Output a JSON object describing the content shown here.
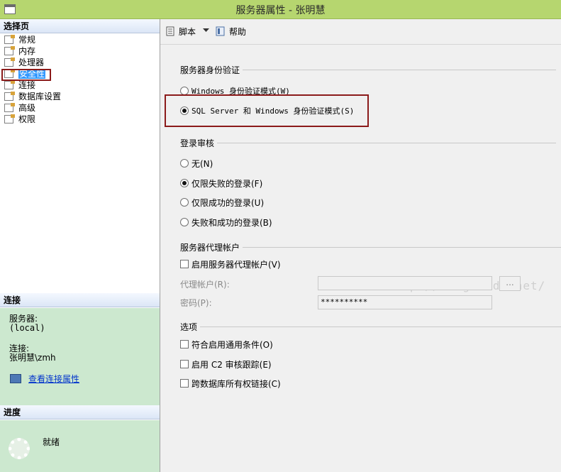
{
  "window": {
    "title": "服务器属性 - 张明慧"
  },
  "left": {
    "select_page_header": "选择页",
    "pages": [
      "常规",
      "内存",
      "处理器",
      "安全性",
      "连接",
      "数据库设置",
      "高级",
      "权限"
    ],
    "selected_index": 3,
    "connection_header": "连接",
    "server_label": "服务器:",
    "server_value": "(local)",
    "connection_label": "连接:",
    "connection_value": "张明慧\\zmh",
    "view_link": "查看连接属性",
    "progress_header": "进度",
    "progress_status": "就绪"
  },
  "toolbar": {
    "script": "脚本",
    "help": "帮助"
  },
  "auth": {
    "title": "服务器身份验证",
    "windows_mode": "Windows 身份验证模式(W)",
    "mixed_mode": "SQL Server 和 Windows 身份验证模式(S)",
    "selected": "mixed"
  },
  "audit": {
    "title": "登录审核",
    "options": [
      "无(N)",
      "仅限失败的登录(F)",
      "仅限成功的登录(U)",
      "失败和成功的登录(B)"
    ],
    "selected_index": 1
  },
  "proxy": {
    "title": "服务器代理帐户",
    "enable": "启用服务器代理帐户(V)",
    "account_label": "代理帐户(R):",
    "account_value": "",
    "password_label": "密码(P):",
    "password_value": "**********",
    "browse_button": "..."
  },
  "options": {
    "title": "选项",
    "items": [
      "符合启用通用条件(O)",
      "启用 C2 审核跟踪(E)",
      "跨数据库所有权链接(C)"
    ]
  },
  "watermark": "http://blog.csdn.net/"
}
